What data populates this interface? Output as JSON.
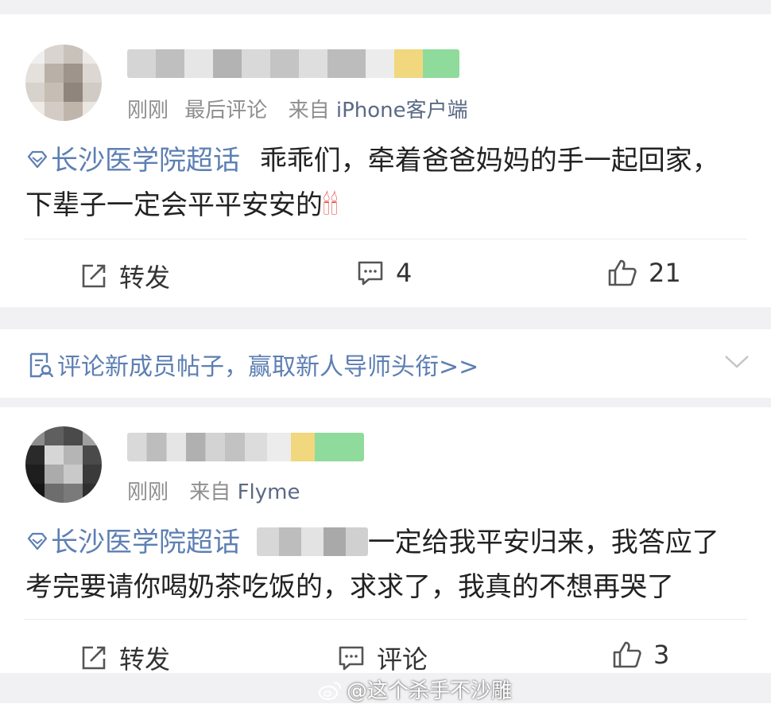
{
  "post1": {
    "meta_time": "刚刚",
    "meta_extra": "最后评论",
    "meta_from": "来自",
    "meta_source": "iPhone客户端",
    "topic": "长沙医学院超话",
    "text": "乖乖们，牵着爸爸妈妈的手一起回家，下辈子一定会平平安安的",
    "emoji": "🕯🕯",
    "actions": {
      "repost": "转发",
      "comments": "4",
      "likes": "21"
    }
  },
  "promo": {
    "text": "评论新成员帖子，赢取新人导师头衔>>"
  },
  "post2": {
    "meta_time": "刚刚",
    "meta_from": "来自",
    "meta_source": "Flyme",
    "topic": "长沙医学院超话",
    "text": "一定给我平安归来，我答应了考完要请你喝奶茶吃饭的，求求了，我真的不想再哭了",
    "actions": {
      "repost": "转发",
      "comments": "评论",
      "likes": "3"
    }
  },
  "watermark": "@这个杀手不沙雕",
  "colors": {
    "link": "#5d7fb3",
    "meta": "#8e8e8e",
    "gap": "#f1f1f3"
  }
}
